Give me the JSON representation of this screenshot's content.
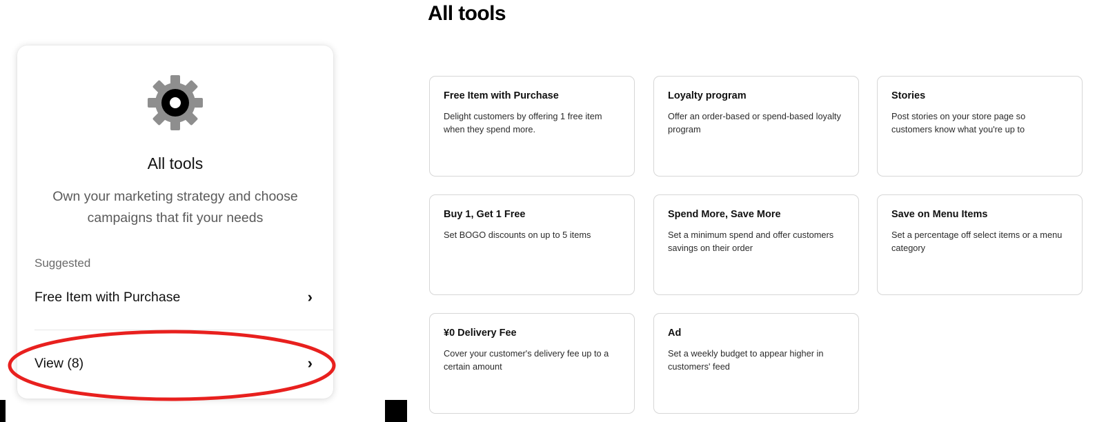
{
  "left_card": {
    "icon": "gear-icon",
    "title": "All tools",
    "description": "Own your marketing strategy and choose campaigns that fit your needs",
    "suggested_label": "Suggested",
    "suggested_item": "Free Item with Purchase",
    "view_all_label": "View (8)"
  },
  "highlight_color": "#e8201e",
  "section": {
    "title": "All tools",
    "tools": [
      {
        "title": "Free Item with Purchase",
        "description": "Delight customers by offering 1 free item when they spend more."
      },
      {
        "title": "Loyalty program",
        "description": "Offer an order-based or spend-based loyalty program"
      },
      {
        "title": "Stories",
        "description": "Post stories on your store page so customers know what you're up to"
      },
      {
        "title": "Buy 1, Get 1 Free",
        "description": "Set BOGO discounts on up to 5 items"
      },
      {
        "title": "Spend More, Save More",
        "description": "Set a minimum spend and offer customers savings on their order"
      },
      {
        "title": "Save on Menu Items",
        "description": "Set a percentage off select items or a menu category"
      },
      {
        "title": "¥0 Delivery Fee",
        "description": "Cover your customer's delivery fee up to a certain amount"
      },
      {
        "title": "Ad",
        "description": "Set a weekly budget to appear higher in customers' feed"
      }
    ]
  }
}
